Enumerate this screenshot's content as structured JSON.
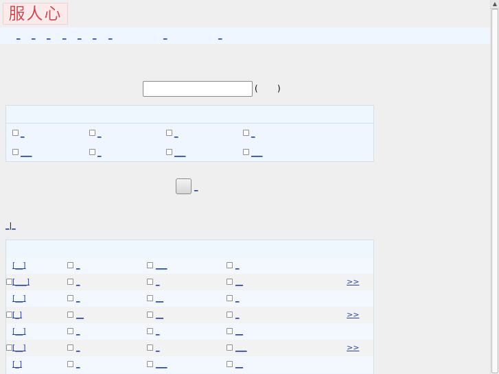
{
  "header": {
    "logo_text": "服人心"
  },
  "nav": {
    "links": [
      "_",
      "_",
      "_",
      "_",
      "_",
      "_",
      "_",
      "_",
      "_"
    ]
  },
  "search": {
    "value": "",
    "paren_open": "(",
    "paren_close": ")"
  },
  "filter_options": [
    "_",
    "_",
    "_",
    "_",
    "___",
    "_",
    "___",
    "___"
  ],
  "submit": {
    "link": "_"
  },
  "view_tabs": {
    "first": "_",
    "separator": "|",
    "second": "_"
  },
  "results": [
    {
      "tag": "[__]",
      "a": "_",
      "b": "___",
      "c": "_",
      "more": ""
    },
    {
      "tag": "[___]",
      "a": "_",
      "b": "_",
      "c": "__",
      "more": ">>"
    },
    {
      "tag": "[__]",
      "a": "_",
      "b": "__",
      "c": "_",
      "more": ""
    },
    {
      "tag": "[_]",
      "a": "__",
      "b": "__",
      "c": "_",
      "more": ">>"
    },
    {
      "tag": "[__]",
      "a": "_",
      "b": "_",
      "c": "__",
      "more": ""
    },
    {
      "tag": "[__]",
      "a": "_",
      "b": "_",
      "c": "___",
      "more": ">>"
    },
    {
      "tag": "[_]",
      "a": "_",
      "b": "___",
      "c": "__",
      "more": ""
    }
  ]
}
